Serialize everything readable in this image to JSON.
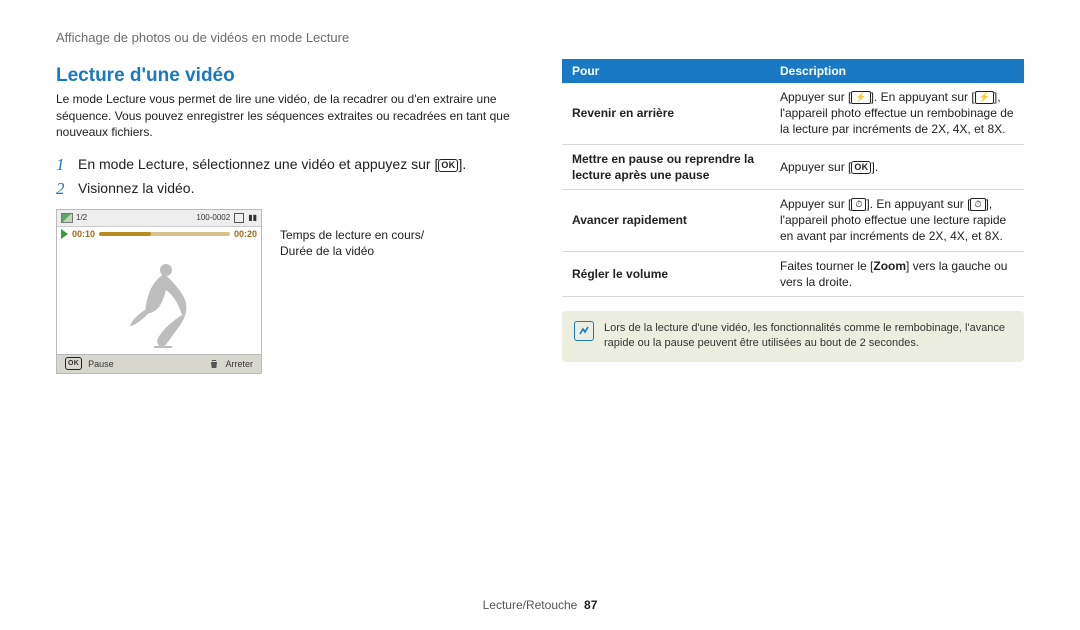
{
  "crumb": "Affichage de photos ou de vidéos en mode Lecture",
  "section_title": "Lecture d'une vidéo",
  "intro": "Le mode Lecture vous permet de lire une vidéo, de la recadrer ou d'en extraire une séquence. Vous pouvez enregistrer les séquences extraites ou recadrées en tant que nouveaux fichiers.",
  "steps": [
    {
      "num": "1",
      "text_pre": "En mode Lecture, sélectionnez une vidéo et appuyez sur [",
      "text_post": "]."
    },
    {
      "num": "2",
      "text_pre": "Visionnez la vidéo.",
      "text_post": ""
    }
  ],
  "ok_label": "OK",
  "bolt_glyph": "⚡",
  "timer_glyph": "⏱",
  "video_caption_l1": "Temps de lecture en cours/",
  "video_caption_l2": "Durée de la vidéo",
  "screen": {
    "counter": "1/2",
    "iso": "100-0002",
    "battery": "▮▮",
    "time_current": "00:10",
    "time_total": "00:20",
    "pause_label": "Pause",
    "stop_label": "Arreter"
  },
  "table": {
    "head_left": "Pour",
    "head_right": "Description",
    "rows": [
      {
        "left": "Revenir en arrière",
        "right_pre": "Appuyer sur [",
        "right_glyph": "bolt",
        "right_mid": "]. En appuyant sur [",
        "right_glyph2": "bolt",
        "right_post": "], l'appareil photo effectue un rembobinage de la lecture par incréments de 2X, 4X, et 8X."
      },
      {
        "left": "Mettre en pause ou reprendre la lecture après une pause",
        "right_pre": "Appuyer sur [",
        "right_glyph": "ok",
        "right_mid": "",
        "right_post": "]."
      },
      {
        "left": "Avancer rapidement",
        "right_pre": "Appuyer sur [",
        "right_glyph": "timer",
        "right_mid": "]. En appuyant sur [",
        "right_glyph2": "timer",
        "right_post": "], l'appareil photo effectue une lecture rapide en avant par incréments de 2X, 4X, et 8X."
      },
      {
        "left": "Régler le volume",
        "right_pre": "Faites tourner le [",
        "right_zoom": "Zoom",
        "right_post": "] vers la gauche ou vers la droite."
      }
    ]
  },
  "note": "Lors de la lecture d'une vidéo, les fonctionnalités comme le rembobinage, l'avance rapide ou la pause peuvent être utilisées au bout de 2 secondes.",
  "footer_text": "Lecture/Retouche",
  "footer_page": "87"
}
